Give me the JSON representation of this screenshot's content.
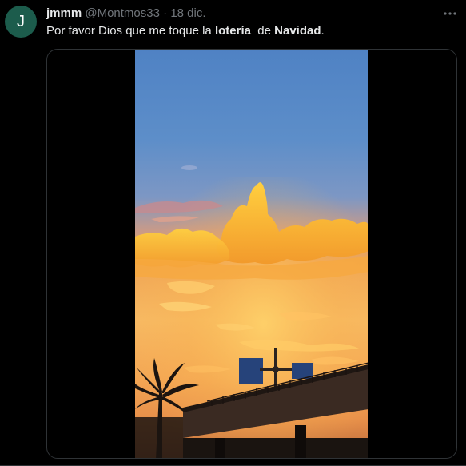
{
  "tweet": {
    "avatar_letter": "J",
    "name": "jmmm",
    "handle": "@Montmos33",
    "separator": "·",
    "date": "18 dic.",
    "text_part1": "Por favor Dios que me toque la ",
    "text_bold1": "lotería",
    "text_part2": "  de ",
    "text_bold2": "Navidad",
    "text_part3": "."
  },
  "colors": {
    "avatar_bg": "#1c5c4c",
    "background": "#000000",
    "secondary_text": "#71767b",
    "primary_text": "#e7e9ea"
  },
  "icons": {
    "more": "more-horizontal-icon"
  }
}
